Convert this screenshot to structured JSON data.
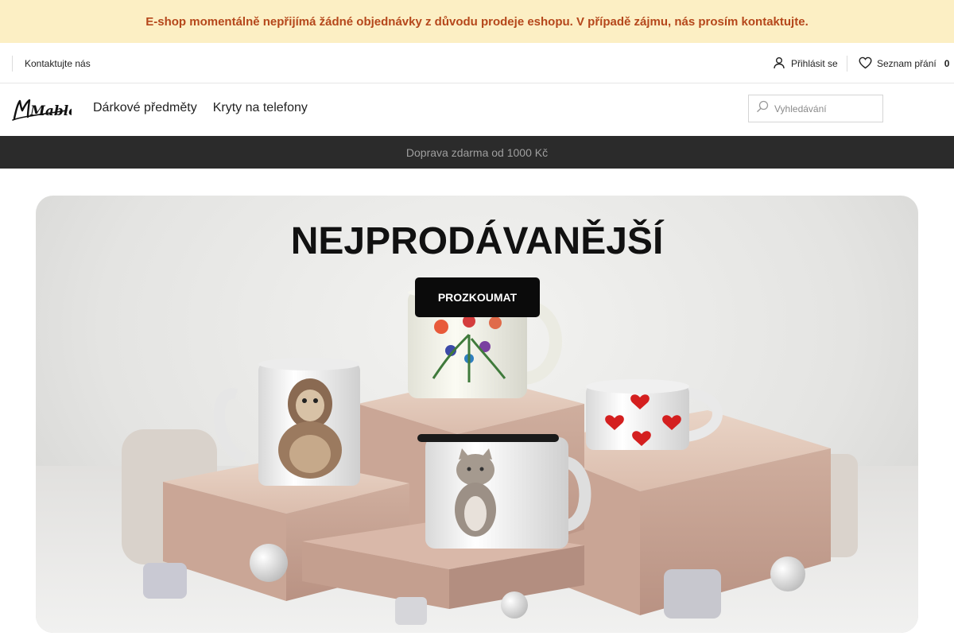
{
  "notice": {
    "text": "E-shop momentálně nepřijímá žádné objednávky z důvodu prodeje eshopu. V případě zájmu, nás prosím kontaktujte."
  },
  "topbar": {
    "contact_label": "Kontaktujte nás",
    "login_label": "Přihlásit se",
    "wishlist_label": "Seznam přání",
    "wishlist_count": "0"
  },
  "header": {
    "logo_text": "Mablo",
    "menu": [
      {
        "label": "Dárkové předměty"
      },
      {
        "label": "Kryty na telefony"
      }
    ],
    "search_placeholder": "Vyhledávání"
  },
  "shipping_bar": {
    "text": "Doprava zdarma od 1000 Kč"
  },
  "hero": {
    "title": "NEJPRODÁVANĚJŠÍ",
    "cta_label": "PROZKOUMAT"
  },
  "colors": {
    "notice_bg": "#fcefc4",
    "notice_text": "#b5471b",
    "shipping_bg": "#2b2b2b",
    "cta_bg": "#0b0b0b"
  },
  "icons": [
    "user-icon",
    "heart-icon",
    "search-icon"
  ]
}
